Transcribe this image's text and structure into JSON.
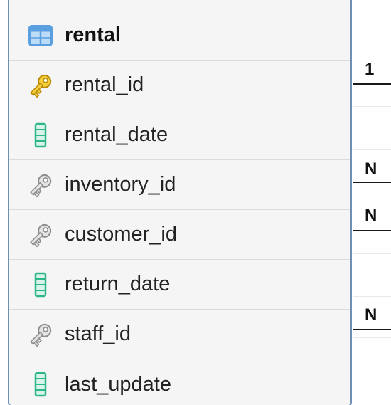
{
  "entity": {
    "title": "rental",
    "columns": [
      {
        "name": "rental_id",
        "icon": "primary-key-icon"
      },
      {
        "name": "rental_date",
        "icon": "column-icon"
      },
      {
        "name": "inventory_id",
        "icon": "foreign-key-icon"
      },
      {
        "name": "customer_id",
        "icon": "foreign-key-icon"
      },
      {
        "name": "return_date",
        "icon": "column-icon"
      },
      {
        "name": "staff_id",
        "icon": "foreign-key-icon"
      },
      {
        "name": "last_update",
        "icon": "column-icon"
      }
    ]
  },
  "relations": [
    {
      "cardinality": "1"
    },
    {
      "cardinality": "N"
    },
    {
      "cardinality": "N"
    },
    {
      "cardinality": "N"
    }
  ],
  "colors": {
    "table_border": "#6f8fb3",
    "primary_key": "#e8b923",
    "foreign_key": "#a9a9a9",
    "column": "#2fb58a",
    "table_icon": "#5aa0e0"
  }
}
